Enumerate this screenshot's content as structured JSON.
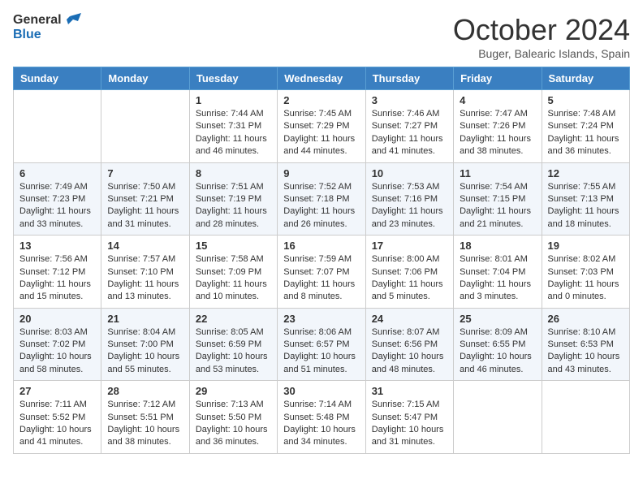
{
  "header": {
    "logo_general": "General",
    "logo_blue": "Blue",
    "month_year": "October 2024",
    "location": "Buger, Balearic Islands, Spain"
  },
  "days_of_week": [
    "Sunday",
    "Monday",
    "Tuesday",
    "Wednesday",
    "Thursday",
    "Friday",
    "Saturday"
  ],
  "weeks": [
    [
      {
        "day": "",
        "sunrise": "",
        "sunset": "",
        "daylight": ""
      },
      {
        "day": "",
        "sunrise": "",
        "sunset": "",
        "daylight": ""
      },
      {
        "day": "1",
        "sunrise": "Sunrise: 7:44 AM",
        "sunset": "Sunset: 7:31 PM",
        "daylight": "Daylight: 11 hours and 46 minutes."
      },
      {
        "day": "2",
        "sunrise": "Sunrise: 7:45 AM",
        "sunset": "Sunset: 7:29 PM",
        "daylight": "Daylight: 11 hours and 44 minutes."
      },
      {
        "day": "3",
        "sunrise": "Sunrise: 7:46 AM",
        "sunset": "Sunset: 7:27 PM",
        "daylight": "Daylight: 11 hours and 41 minutes."
      },
      {
        "day": "4",
        "sunrise": "Sunrise: 7:47 AM",
        "sunset": "Sunset: 7:26 PM",
        "daylight": "Daylight: 11 hours and 38 minutes."
      },
      {
        "day": "5",
        "sunrise": "Sunrise: 7:48 AM",
        "sunset": "Sunset: 7:24 PM",
        "daylight": "Daylight: 11 hours and 36 minutes."
      }
    ],
    [
      {
        "day": "6",
        "sunrise": "Sunrise: 7:49 AM",
        "sunset": "Sunset: 7:23 PM",
        "daylight": "Daylight: 11 hours and 33 minutes."
      },
      {
        "day": "7",
        "sunrise": "Sunrise: 7:50 AM",
        "sunset": "Sunset: 7:21 PM",
        "daylight": "Daylight: 11 hours and 31 minutes."
      },
      {
        "day": "8",
        "sunrise": "Sunrise: 7:51 AM",
        "sunset": "Sunset: 7:19 PM",
        "daylight": "Daylight: 11 hours and 28 minutes."
      },
      {
        "day": "9",
        "sunrise": "Sunrise: 7:52 AM",
        "sunset": "Sunset: 7:18 PM",
        "daylight": "Daylight: 11 hours and 26 minutes."
      },
      {
        "day": "10",
        "sunrise": "Sunrise: 7:53 AM",
        "sunset": "Sunset: 7:16 PM",
        "daylight": "Daylight: 11 hours and 23 minutes."
      },
      {
        "day": "11",
        "sunrise": "Sunrise: 7:54 AM",
        "sunset": "Sunset: 7:15 PM",
        "daylight": "Daylight: 11 hours and 21 minutes."
      },
      {
        "day": "12",
        "sunrise": "Sunrise: 7:55 AM",
        "sunset": "Sunset: 7:13 PM",
        "daylight": "Daylight: 11 hours and 18 minutes."
      }
    ],
    [
      {
        "day": "13",
        "sunrise": "Sunrise: 7:56 AM",
        "sunset": "Sunset: 7:12 PM",
        "daylight": "Daylight: 11 hours and 15 minutes."
      },
      {
        "day": "14",
        "sunrise": "Sunrise: 7:57 AM",
        "sunset": "Sunset: 7:10 PM",
        "daylight": "Daylight: 11 hours and 13 minutes."
      },
      {
        "day": "15",
        "sunrise": "Sunrise: 7:58 AM",
        "sunset": "Sunset: 7:09 PM",
        "daylight": "Daylight: 11 hours and 10 minutes."
      },
      {
        "day": "16",
        "sunrise": "Sunrise: 7:59 AM",
        "sunset": "Sunset: 7:07 PM",
        "daylight": "Daylight: 11 hours and 8 minutes."
      },
      {
        "day": "17",
        "sunrise": "Sunrise: 8:00 AM",
        "sunset": "Sunset: 7:06 PM",
        "daylight": "Daylight: 11 hours and 5 minutes."
      },
      {
        "day": "18",
        "sunrise": "Sunrise: 8:01 AM",
        "sunset": "Sunset: 7:04 PM",
        "daylight": "Daylight: 11 hours and 3 minutes."
      },
      {
        "day": "19",
        "sunrise": "Sunrise: 8:02 AM",
        "sunset": "Sunset: 7:03 PM",
        "daylight": "Daylight: 11 hours and 0 minutes."
      }
    ],
    [
      {
        "day": "20",
        "sunrise": "Sunrise: 8:03 AM",
        "sunset": "Sunset: 7:02 PM",
        "daylight": "Daylight: 10 hours and 58 minutes."
      },
      {
        "day": "21",
        "sunrise": "Sunrise: 8:04 AM",
        "sunset": "Sunset: 7:00 PM",
        "daylight": "Daylight: 10 hours and 55 minutes."
      },
      {
        "day": "22",
        "sunrise": "Sunrise: 8:05 AM",
        "sunset": "Sunset: 6:59 PM",
        "daylight": "Daylight: 10 hours and 53 minutes."
      },
      {
        "day": "23",
        "sunrise": "Sunrise: 8:06 AM",
        "sunset": "Sunset: 6:57 PM",
        "daylight": "Daylight: 10 hours and 51 minutes."
      },
      {
        "day": "24",
        "sunrise": "Sunrise: 8:07 AM",
        "sunset": "Sunset: 6:56 PM",
        "daylight": "Daylight: 10 hours and 48 minutes."
      },
      {
        "day": "25",
        "sunrise": "Sunrise: 8:09 AM",
        "sunset": "Sunset: 6:55 PM",
        "daylight": "Daylight: 10 hours and 46 minutes."
      },
      {
        "day": "26",
        "sunrise": "Sunrise: 8:10 AM",
        "sunset": "Sunset: 6:53 PM",
        "daylight": "Daylight: 10 hours and 43 minutes."
      }
    ],
    [
      {
        "day": "27",
        "sunrise": "Sunrise: 7:11 AM",
        "sunset": "Sunset: 5:52 PM",
        "daylight": "Daylight: 10 hours and 41 minutes."
      },
      {
        "day": "28",
        "sunrise": "Sunrise: 7:12 AM",
        "sunset": "Sunset: 5:51 PM",
        "daylight": "Daylight: 10 hours and 38 minutes."
      },
      {
        "day": "29",
        "sunrise": "Sunrise: 7:13 AM",
        "sunset": "Sunset: 5:50 PM",
        "daylight": "Daylight: 10 hours and 36 minutes."
      },
      {
        "day": "30",
        "sunrise": "Sunrise: 7:14 AM",
        "sunset": "Sunset: 5:48 PM",
        "daylight": "Daylight: 10 hours and 34 minutes."
      },
      {
        "day": "31",
        "sunrise": "Sunrise: 7:15 AM",
        "sunset": "Sunset: 5:47 PM",
        "daylight": "Daylight: 10 hours and 31 minutes."
      },
      {
        "day": "",
        "sunrise": "",
        "sunset": "",
        "daylight": ""
      },
      {
        "day": "",
        "sunrise": "",
        "sunset": "",
        "daylight": ""
      }
    ]
  ]
}
